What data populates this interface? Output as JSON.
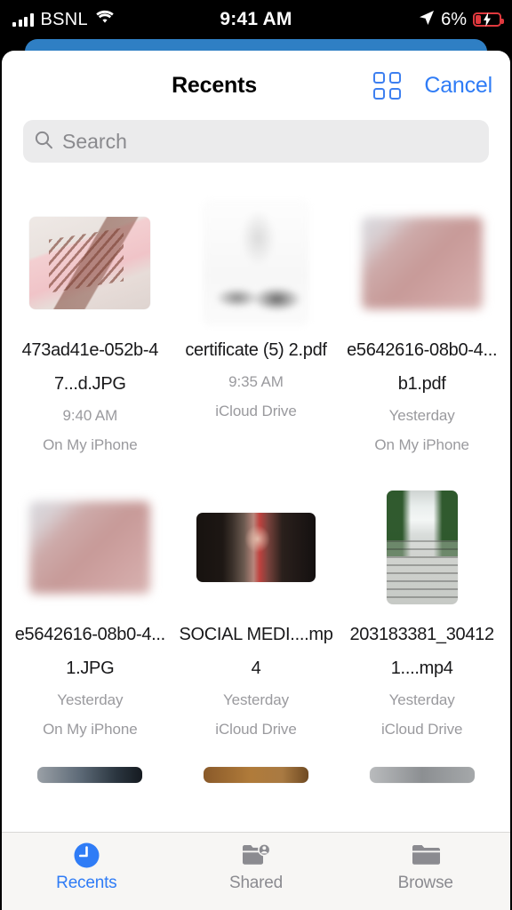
{
  "status_bar": {
    "carrier": "BSNL",
    "time": "9:41 AM",
    "battery_percent": "6%",
    "signal_icon": "cellular-bars-icon",
    "wifi_icon": "wifi-icon",
    "location_icon": "location-arrow-icon",
    "battery_icon": "battery-charging-icon",
    "battery_color": "#e0393e"
  },
  "header": {
    "title": "Recents",
    "grid_view_icon": "grid-view-icon",
    "cancel_label": "Cancel",
    "accent_color": "#2f7cf6"
  },
  "search": {
    "placeholder": "Search",
    "icon": "search-icon"
  },
  "files": [
    {
      "name": "473ad41e-052b-47...d.JPG",
      "time": "9:40 AM",
      "location": "On My iPhone",
      "thumb": "t-saree"
    },
    {
      "name": "certificate (5) 2.pdf",
      "time": "9:35 AM",
      "location": "iCloud Drive",
      "thumb": "t-doc"
    },
    {
      "name": "e5642616-08b0-4...b1.pdf",
      "time": "Yesterday",
      "location": "On My iPhone",
      "thumb": "t-pinkblur"
    },
    {
      "name": "e5642616-08b0-4...1.JPG",
      "time": "Yesterday",
      "location": "On My iPhone",
      "thumb": "t-pinkblur"
    },
    {
      "name": "SOCIAL MEDI....mp4",
      "time": "Yesterday",
      "location": "iCloud Drive",
      "thumb": "t-video"
    },
    {
      "name": "203183381_304121....mp4",
      "time": "Yesterday",
      "location": "iCloud Drive",
      "thumb": "t-stairs"
    }
  ],
  "tabs": [
    {
      "label": "Recents",
      "icon": "clock-icon",
      "active": true
    },
    {
      "label": "Shared",
      "icon": "folder-person-icon",
      "active": false
    },
    {
      "label": "Browse",
      "icon": "folder-icon",
      "active": false
    }
  ]
}
